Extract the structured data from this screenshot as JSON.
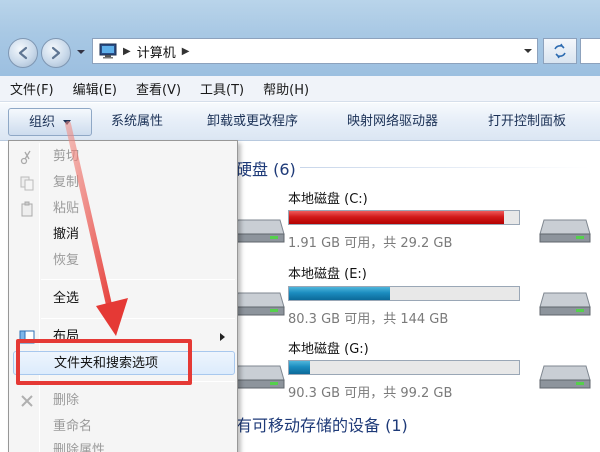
{
  "address": {
    "path_label": "计算机",
    "icons": [
      "computer-icon",
      "chevron-right-icon",
      "refresh-icon"
    ]
  },
  "menubar": {
    "items": [
      "文件(F)",
      "编辑(E)",
      "查看(V)",
      "工具(T)",
      "帮助(H)"
    ]
  },
  "toolbar": {
    "organize_label": "组织",
    "items": [
      "系统属性",
      "卸载或更改程序",
      "映射网络驱动器",
      "打开控制面板"
    ]
  },
  "groups": {
    "hdd_header": "硬盘 (6)",
    "removable_header": "有可移动存储的设备 (1)"
  },
  "drives": [
    {
      "name": "本地磁盘 (C:)",
      "info": "1.91 GB 可用，共 29.2 GB",
      "used_fraction": 0.935,
      "bar_color": "#c81010"
    },
    {
      "name": "本地磁盘 (E:)",
      "info": "80.3 GB 可用，共 144 GB",
      "used_fraction": 0.44,
      "bar_color": "#1b8cbf"
    },
    {
      "name": "本地磁盘 (G:)",
      "info": "90.3 GB 可用，共 99.2 GB",
      "used_fraction": 0.09,
      "bar_color": "#1b8cbf"
    }
  ],
  "organize_menu": {
    "items": [
      {
        "label": "剪切",
        "enabled": false,
        "icon": "scissors-icon"
      },
      {
        "label": "复制",
        "enabled": false,
        "icon": "copy-icon"
      },
      {
        "label": "粘贴",
        "enabled": false,
        "icon": "paste-icon"
      },
      {
        "label": "撤消",
        "enabled": true,
        "icon": ""
      },
      {
        "label": "恢复",
        "enabled": false,
        "icon": ""
      },
      {
        "label": "全选",
        "enabled": true,
        "icon": ""
      },
      {
        "label": "布局",
        "enabled": true,
        "icon": "layout-icon",
        "submenu": true
      },
      {
        "label": "文件夹和搜索选项",
        "enabled": true,
        "icon": "",
        "highlighted": true
      },
      {
        "label": "删除",
        "enabled": false,
        "icon": "delete-x-icon"
      },
      {
        "label": "重命名",
        "enabled": false,
        "icon": ""
      },
      {
        "label": "删除属性",
        "enabled": false,
        "icon": ""
      }
    ]
  },
  "annotation": {
    "highlight_color": "#e53935"
  }
}
